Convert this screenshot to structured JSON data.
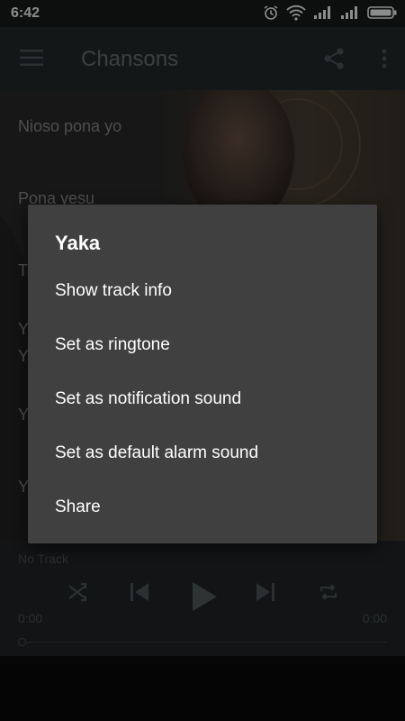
{
  "status_bar": {
    "time": "6:42"
  },
  "toolbar": {
    "title": "Chansons"
  },
  "songs": [
    "Nioso pona yo",
    "Pona yesu",
    "T",
    "Y",
    "Y",
    "Y",
    "Y"
  ],
  "player": {
    "now_playing": "No Track",
    "elapsed": "0:00",
    "duration": "0:00",
    "progress": 0
  },
  "dialog": {
    "title": "Yaka",
    "items": [
      "Show track info",
      "Set as ringtone",
      "Set as notification sound",
      "Set as default alarm sound",
      "Share"
    ]
  },
  "icons": {
    "status": [
      "alarm-icon",
      "wifi-icon",
      "signal-icon",
      "signal-icon",
      "battery-icon"
    ],
    "toolbar": [
      "hamburger-menu-icon",
      "share-icon",
      "overflow-menu-icon"
    ],
    "player": [
      "shuffle-icon",
      "previous-icon",
      "play-icon",
      "next-icon",
      "repeat-icon"
    ]
  },
  "colors": {
    "toolbar": "#252a2c",
    "dialog": "#404040",
    "player": "#222627",
    "statusbar": "#181c1d"
  }
}
